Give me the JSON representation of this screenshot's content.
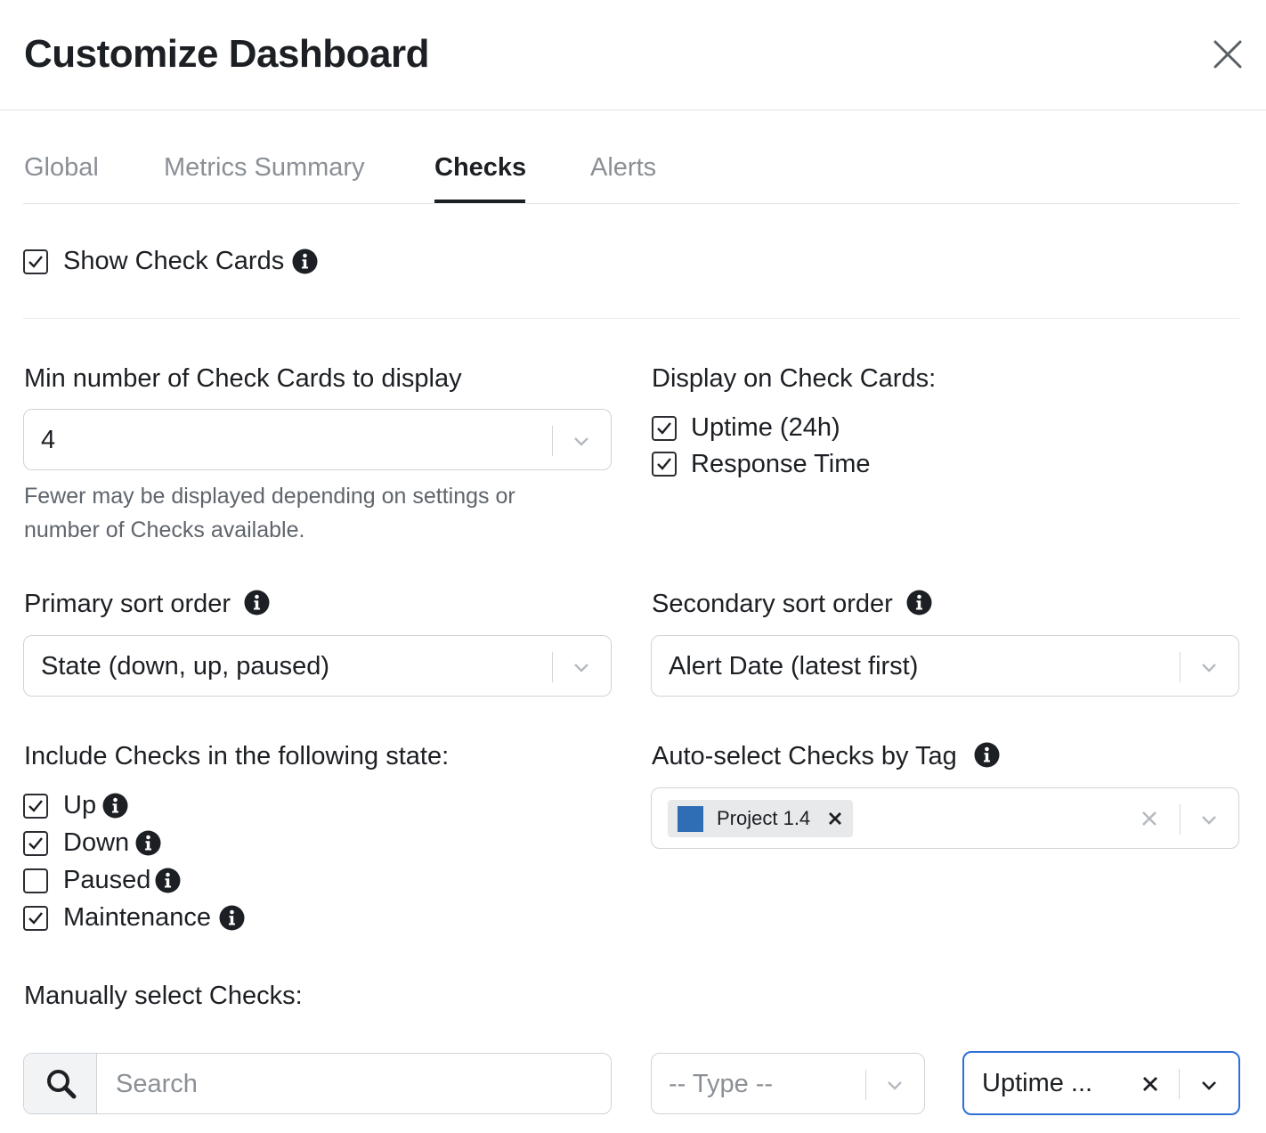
{
  "dialog": {
    "title": "Customize Dashboard"
  },
  "tabs": [
    {
      "label": "Global",
      "active": false
    },
    {
      "label": "Metrics Summary",
      "active": false
    },
    {
      "label": "Checks",
      "active": true
    },
    {
      "label": "Alerts",
      "active": false
    }
  ],
  "show_cards": {
    "label": "Show Check Cards",
    "checked": true
  },
  "min_cards": {
    "label": "Min number of Check Cards to display",
    "value": "4",
    "hint": "Fewer may be displayed depending on settings or number of Checks available."
  },
  "display_on_cards": {
    "label": "Display on Check Cards:",
    "options": [
      {
        "label": "Uptime (24h)",
        "checked": true
      },
      {
        "label": "Response Time",
        "checked": true
      }
    ]
  },
  "primary_sort": {
    "label": "Primary sort order",
    "value": "State (down, up, paused)"
  },
  "secondary_sort": {
    "label": "Secondary sort order",
    "value": "Alert Date (latest first)"
  },
  "include_states": {
    "label": "Include Checks in the following state:",
    "options": [
      {
        "label": "Up",
        "checked": true
      },
      {
        "label": "Down",
        "checked": true
      },
      {
        "label": "Paused",
        "checked": false
      },
      {
        "label": "Maintenance",
        "checked": true
      }
    ]
  },
  "auto_select_tag": {
    "label": "Auto-select Checks by Tag",
    "chips": [
      {
        "label": "Project 1.4",
        "color": "#2f6db5"
      }
    ]
  },
  "manual_select": {
    "label": "Manually select Checks:",
    "search_placeholder": "Search",
    "type_placeholder": "-- Type --",
    "sort_value": "Uptime ..."
  },
  "colors": {
    "accent": "#2f6fd6",
    "text": "#1c1f23",
    "muted": "#8b9096",
    "border": "#cfd3d8"
  }
}
